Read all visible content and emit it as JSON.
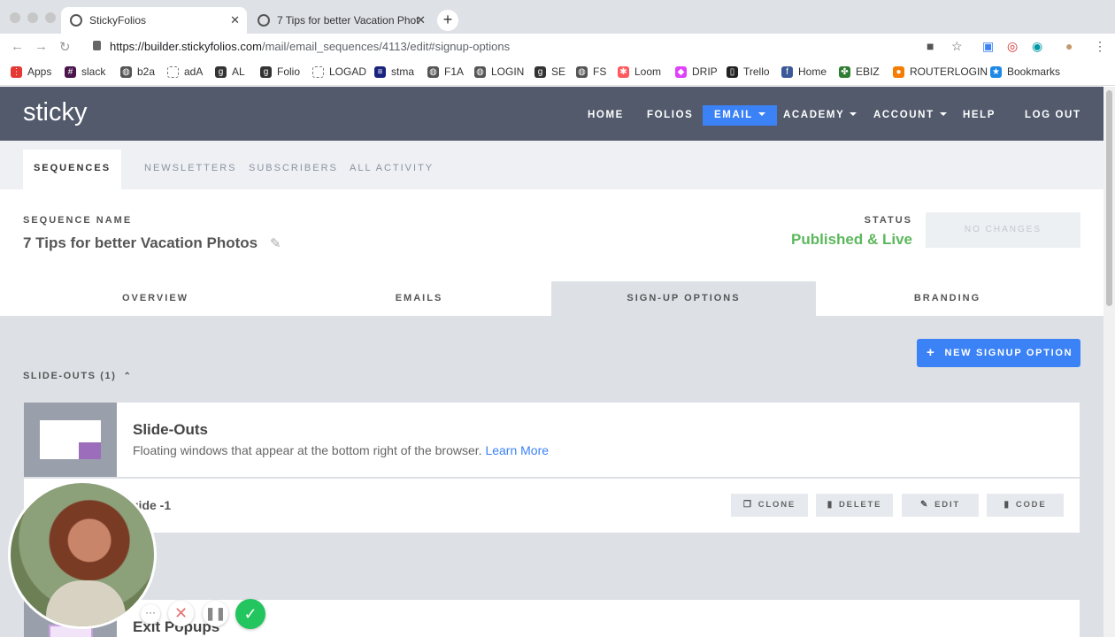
{
  "browser": {
    "tabs": [
      {
        "title": "StickyFolios"
      },
      {
        "title": "7 Tips for better Vacation Phot"
      }
    ],
    "url_host": "https://builder.stickyfolios.com",
    "url_path": "/mail/email_sequences/4113/edit#signup-options",
    "bookmarks": [
      {
        "label": "Apps",
        "icon": "apps-grid-icon",
        "color": "#e53935"
      },
      {
        "label": "slack",
        "icon": "slack-icon",
        "color": "#4a154b"
      },
      {
        "label": "b2a",
        "icon": "globe-icon",
        "color": "#555555"
      },
      {
        "label": "adA",
        "icon": "dashed-square-icon",
        "color": "#888888"
      },
      {
        "label": "AL",
        "icon": "g-icon",
        "color": "#333333"
      },
      {
        "label": "Folio",
        "icon": "g-icon",
        "color": "#333333"
      },
      {
        "label": "LOGAD",
        "icon": "dashed-square-icon",
        "color": "#888888"
      },
      {
        "label": "stma",
        "icon": "stma-icon",
        "color": "#1a237e"
      },
      {
        "label": "F1A",
        "icon": "globe-icon",
        "color": "#555555"
      },
      {
        "label": "LOGIN",
        "icon": "globe-icon",
        "color": "#555555"
      },
      {
        "label": "SE",
        "icon": "g-icon",
        "color": "#333333"
      },
      {
        "label": "FS",
        "icon": "globe-icon",
        "color": "#555555"
      },
      {
        "label": "Loom",
        "icon": "loom-icon",
        "color": "#ff5a5f"
      },
      {
        "label": "DRIP",
        "icon": "drip-icon",
        "color": "#e040fb"
      },
      {
        "label": "Trello",
        "icon": "trello-icon",
        "color": "#222222"
      },
      {
        "label": "Home",
        "icon": "facebook-icon",
        "color": "#3b5998"
      },
      {
        "label": "EBIZ",
        "icon": "clover-icon",
        "color": "#2e7d32"
      },
      {
        "label": "ROUTERLOGIN",
        "icon": "router-icon",
        "color": "#f57c00"
      },
      {
        "label": "Bookmarks",
        "icon": "star-icon",
        "color": "#1e88e5"
      }
    ]
  },
  "app": {
    "logo": "sticky",
    "nav": {
      "home": "HOME",
      "folios": "FOLIOS",
      "email": "EMAIL",
      "academy": "ACADEMY",
      "account": "ACCOUNT",
      "help": "HELP",
      "logout": "LOG OUT"
    },
    "subnav": {
      "sequences": "SEQUENCES",
      "newsletters": "NEWSLETTERS",
      "subscribers": "SUBSCRIBERS",
      "all_activity": "ALL ACTIVITY"
    }
  },
  "sequence": {
    "name_label": "SEQUENCE NAME",
    "name": "7 Tips for better Vacation Photos",
    "status_label": "STATUS",
    "status": "Published & Live",
    "status_color": "#5cb85c",
    "save_button": "NO CHANGES"
  },
  "tabs": {
    "overview": "OVERVIEW",
    "emails": "EMAILS",
    "signup_options": "SIGN-UP OPTIONS",
    "branding": "BRANDING"
  },
  "signup": {
    "new_button": "NEW SIGNUP OPTION",
    "slideouts_header": "SLIDE-OUTS (1)",
    "slideouts": {
      "title": "Slide-Outs",
      "description": "Floating windows that appear at the bottom right of the browser.",
      "learn_more": "Learn More"
    },
    "item": {
      "name": "uide -1",
      "clone": "CLONE",
      "delete": "DELETE",
      "edit": "EDIT",
      "code": "CODE"
    },
    "exit_popups": {
      "title": "Exit Popups"
    }
  },
  "recorder": {
    "dots": "···"
  },
  "colors": {
    "header_bg": "#525a6c",
    "accent": "#3b82f6",
    "content_bg": "#dde1e6",
    "recorder_done": "#22c55e"
  }
}
